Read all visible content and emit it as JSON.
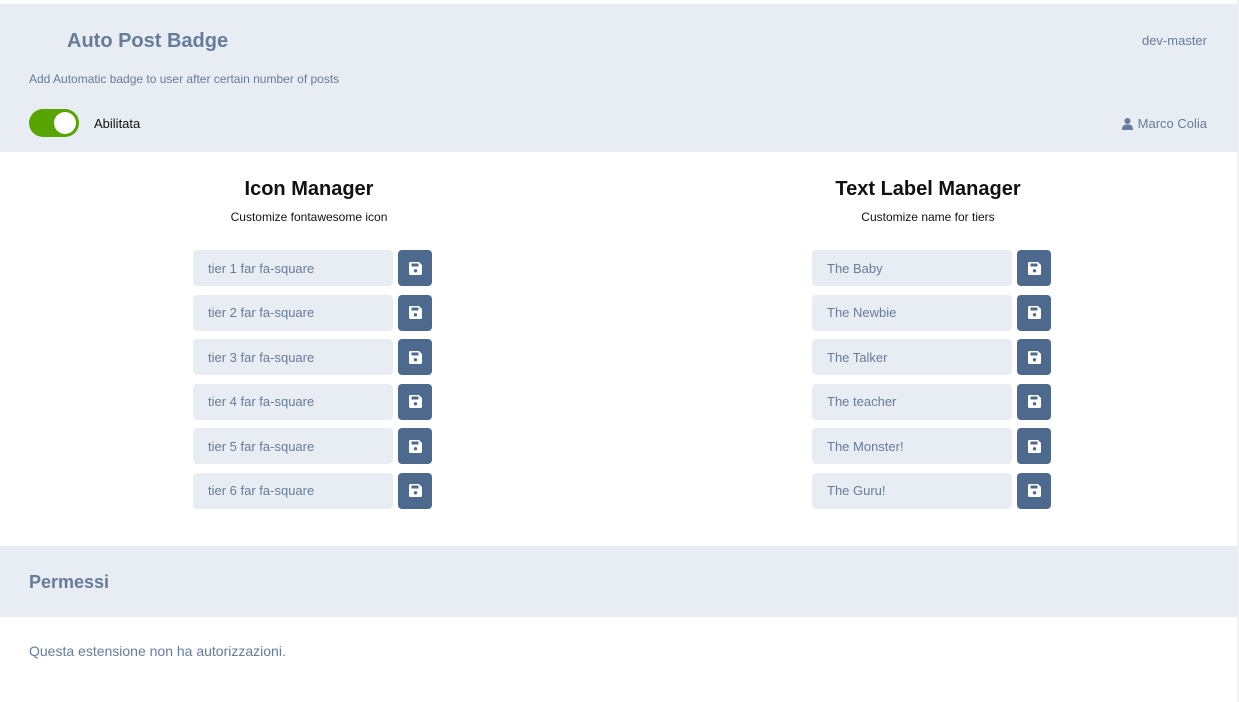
{
  "header": {
    "title": "Auto Post Badge",
    "version": "dev-master",
    "description": "Add Automatic badge to user after certain number of posts",
    "toggle_label": "Abilitata",
    "toggle_on": true,
    "author": "Marco Colia",
    "author_icon": "user-icon"
  },
  "icon_manager": {
    "title": "Icon Manager",
    "subtitle": "Customize fontawesome icon",
    "placeholders": [
      "tier 1 far fa-square",
      "tier 2 far fa-square",
      "tier 3 far fa-square",
      "tier 4 far fa-square",
      "tier 5 far fa-square",
      "tier 6 far fa-square"
    ]
  },
  "label_manager": {
    "title": "Text Label Manager",
    "subtitle": "Customize name for tiers",
    "placeholders": [
      "The Baby",
      "The Newbie",
      "The Talker",
      "The teacher",
      "The Monster!",
      "The Guru!"
    ]
  },
  "permissions": {
    "title": "Permessi",
    "text": "Questa estensione non ha autorizzazioni."
  },
  "colors": {
    "header_bg": "#e8ecf3",
    "muted_text": "#667c99",
    "toggle_on": "#58a400",
    "button_bg": "#4d698e"
  }
}
